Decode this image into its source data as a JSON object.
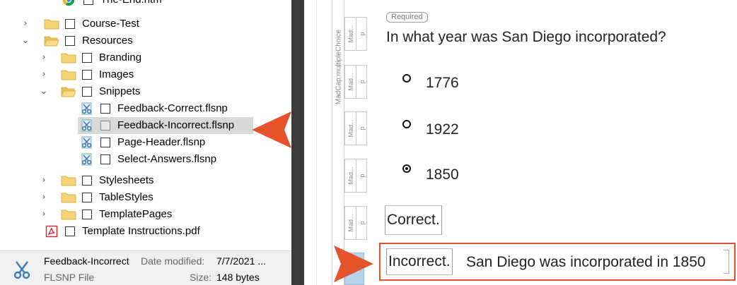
{
  "colors": {
    "accent_arrow": "#e5532b",
    "highlight_frame": "#e0502e",
    "selected_row": "#d9d9d9",
    "splitter": "#3b3b3b"
  },
  "file_tree": {
    "items": [
      {
        "label": "The-End.htm",
        "icon": "chrome-icon",
        "chevron": ""
      },
      {
        "label": "Course-Test",
        "icon": "folder-icon",
        "chevron": "›"
      },
      {
        "label": "Resources",
        "icon": "folder-open-icon",
        "chevron": "⌄"
      },
      {
        "label": "Branding",
        "icon": "folder-icon",
        "chevron": "›"
      },
      {
        "label": "Images",
        "icon": "folder-icon",
        "chevron": "›"
      },
      {
        "label": "Snippets",
        "icon": "folder-open-icon",
        "chevron": "⌄"
      },
      {
        "label": "Feedback-Correct.flsnp",
        "icon": "snippet-file-icon",
        "chevron": ""
      },
      {
        "label": "Feedback-Incorrect.flsnp",
        "icon": "snippet-file-icon",
        "chevron": "",
        "selected": true
      },
      {
        "label": "Page-Header.flsnp",
        "icon": "snippet-file-icon",
        "chevron": ""
      },
      {
        "label": "Select-Answers.flsnp",
        "icon": "snippet-file-icon",
        "chevron": ""
      },
      {
        "label": "Stylesheets",
        "icon": "folder-icon",
        "chevron": "›"
      },
      {
        "label": "TableStyles",
        "icon": "folder-icon",
        "chevron": "›"
      },
      {
        "label": "TemplatePages",
        "icon": "folder-icon",
        "chevron": "›"
      },
      {
        "label": "Template Instructions.pdf",
        "icon": "pdf-icon",
        "chevron": ""
      }
    ]
  },
  "details": {
    "file_name": "Feedback-Incorrect",
    "date_label": "Date modified:",
    "date_value": "7/7/2021 ...",
    "file_type": "FLSNP File",
    "size_label": "Size:",
    "size_value": "148 bytes"
  },
  "editor": {
    "structure_bar_label": "MadCap:multipleChoice",
    "block_labels": {
      "mad": "Mad...",
      "p": "p"
    },
    "required_tag": "Required",
    "question": "In what year was San Diego incorporated?",
    "options": [
      {
        "label": "1776",
        "checked": false
      },
      {
        "label": "1922",
        "checked": false
      },
      {
        "label": "1850",
        "checked": true
      }
    ],
    "correct_feedback": "Correct.",
    "incorrect_label": "Incorrect.",
    "incorrect_text": "San Diego was incorporated in 1850"
  }
}
